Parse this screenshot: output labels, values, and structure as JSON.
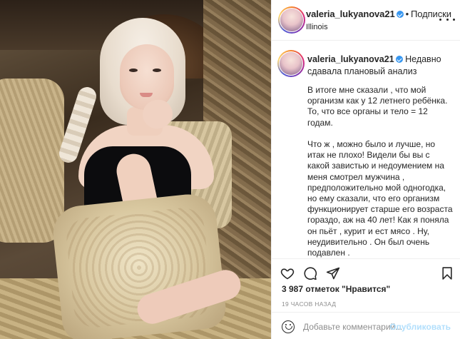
{
  "post": {
    "username": "valeria_lukyanova21",
    "follow_label": "Подписки",
    "separator": "•",
    "location": "Illinois"
  },
  "caption": {
    "username": "valeria_lukyanova21",
    "intro": "Недавно сдавала плановый анализ",
    "body": "В итоге мне сказали , что мой организм как у 12 летнего ребёнка. То, что все органы и тело = 12 годам.\n\nЧто ж , можно было и лучше, но итак не плохо! Видели бы вы с какой завистью и недоумением на меня смотрел мужчина , предположительно мой одногодка, но ему сказали, что его организм функционирует старше его возраста гораздо, аж на 40 лет! Как я поняла он пьёт , курит и ест мясо . Ну, неудивительно . Он был очень подавлен ."
  },
  "actions": {
    "like_icon": "heart-icon",
    "comment_icon": "comment-icon",
    "share_icon": "paper-plane-icon",
    "save_icon": "bookmark-icon"
  },
  "likes_text": "3 987 отметок \"Нравится\"",
  "timestamp": "19 ЧАСОВ НАЗАД",
  "comment": {
    "placeholder": "Добавьте комментарий...",
    "publish_label": "Опубликовать",
    "emoji_icon": "emoji-icon"
  },
  "colors": {
    "verified": "#3897f0",
    "publish_disabled": "#b2dffc",
    "muted_text": "#8e8e8e"
  }
}
